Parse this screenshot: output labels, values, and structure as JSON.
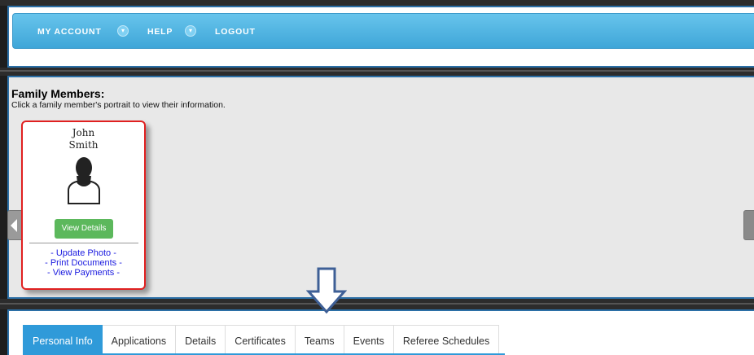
{
  "nav": {
    "items": [
      {
        "label": "MY ACCOUNT",
        "has_dropdown": true,
        "icon": "chevron-down-icon"
      },
      {
        "label": "HELP",
        "has_dropdown": true,
        "icon": "chevron-down-icon"
      },
      {
        "label": "LOGOUT",
        "has_dropdown": false
      }
    ],
    "color": "#4db3e2"
  },
  "family": {
    "title": "Family Members:",
    "subtitle": "Click a family member's portrait to view their information.",
    "members": [
      {
        "first_name": "John",
        "last_name": "Smith",
        "avatar_icon": "person-silhouette-icon",
        "view_button": "View Details",
        "links": [
          "- Update Photo -",
          "- Print Documents -",
          "- View Payments -"
        ]
      }
    ],
    "carousel_left_icon": "chevron-left-icon",
    "carousel_right_icon": "chevron-right-icon"
  },
  "annotation": {
    "icon": "down-arrow-icon",
    "color": "#3e5f96"
  },
  "tabs": {
    "items": [
      "Personal Info",
      "Applications",
      "Details",
      "Certificates",
      "Teams",
      "Events",
      "Referee Schedules"
    ],
    "active": "Personal Info",
    "active_color": "#2f9ad9"
  },
  "colors": {
    "panel_border": "#2b6fa6",
    "card_border": "#e02020",
    "button_green": "#5cb85c",
    "link_blue": "#1a1adf"
  }
}
